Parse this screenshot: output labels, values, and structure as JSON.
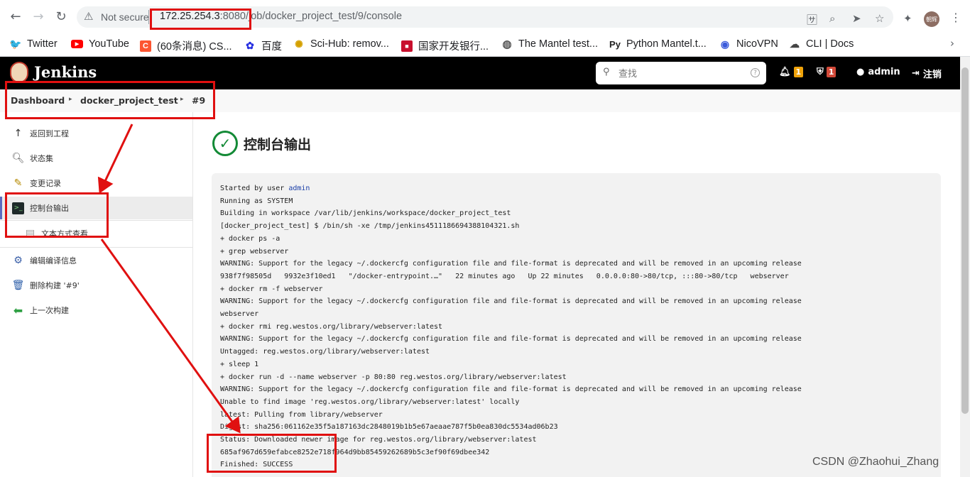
{
  "browser": {
    "security_label": "Not secure",
    "url_host": "172.25.254.3",
    "url_rest": ":8080/job/docker_project_test/9/console",
    "profile_label": "朝辉"
  },
  "bookmarks": [
    {
      "label": "Twitter",
      "color": "#1da1f2",
      "icon": "twitter-icon"
    },
    {
      "label": "YouTube",
      "color": "#ff0000",
      "icon": "youtube-icon"
    },
    {
      "label": "(60条消息) CS...",
      "color": "#fc5531",
      "icon": "csdn-icon"
    },
    {
      "label": "百度",
      "color": "#2932e1",
      "icon": "baidu-icon"
    },
    {
      "label": "Sci-Hub: remov...",
      "color": "#d4a000",
      "icon": "scihub-icon"
    },
    {
      "label": "国家开发银行...",
      "color": "#c8102e",
      "icon": "cdb-icon"
    },
    {
      "label": "The Mantel test...",
      "color": "#555555",
      "icon": "globe-icon"
    },
    {
      "label": "Python Mantel.t...",
      "color": "#222222",
      "icon": "python-icon"
    },
    {
      "label": "NicoVPN",
      "color": "#3b5bdb",
      "icon": "vpn-icon"
    },
    {
      "label": "CLI | Docs",
      "color": "#444444",
      "icon": "cloud-icon"
    }
  ],
  "jenkins": {
    "title": "Jenkins",
    "search_placeholder": "查找",
    "notifications_count": "1",
    "security_count": "1",
    "user": "admin",
    "logout": "注销",
    "colors": {
      "notif_badge": "#f0a30a",
      "security_badge": "#d24939",
      "success": "#138a36",
      "active_bar": "#5c6bc0"
    }
  },
  "breadcrumb": {
    "items": [
      "Dashboard",
      "docker_project_test",
      "#9"
    ]
  },
  "sidebar": {
    "items": [
      {
        "label": "返回到工程",
        "icon": "arrow-up-icon"
      },
      {
        "label": "状态集",
        "icon": "search-icon"
      },
      {
        "label": "变更记录",
        "icon": "notepad-icon"
      },
      {
        "label": "控制台输出",
        "icon": "terminal-icon"
      },
      {
        "label": "文本方式查看",
        "icon": "document-icon"
      },
      {
        "label": "编辑编译信息",
        "icon": "gear-icon"
      },
      {
        "label": "删除构建 '#9'",
        "icon": "trash-icon"
      },
      {
        "label": "上一次构建",
        "icon": "arrow-left-icon"
      }
    ]
  },
  "main": {
    "title": "控制台输出",
    "console_user": "admin",
    "console_lines": [
      "Started by user ",
      "Running as SYSTEM",
      "Building in workspace /var/lib/jenkins/workspace/docker_project_test",
      "[docker_project_test] $ /bin/sh -xe /tmp/jenkins4511186694388104321.sh",
      "+ docker ps -a",
      "+ grep webserver",
      "WARNING: Support for the legacy ~/.dockercfg configuration file and file-format is deprecated and will be removed in an upcoming release",
      "938f7f98505d   9932e3f10ed1   \"/docker-entrypoint.…\"   22 minutes ago   Up 22 minutes   0.0.0.0:80->80/tcp, :::80->80/tcp   webserver",
      "+ docker rm -f webserver",
      "WARNING: Support for the legacy ~/.dockercfg configuration file and file-format is deprecated and will be removed in an upcoming release",
      "webserver",
      "+ docker rmi reg.westos.org/library/webserver:latest",
      "WARNING: Support for the legacy ~/.dockercfg configuration file and file-format is deprecated and will be removed in an upcoming release",
      "Untagged: reg.westos.org/library/webserver:latest",
      "+ sleep 1",
      "+ docker run -d --name webserver -p 80:80 reg.westos.org/library/webserver:latest",
      "WARNING: Support for the legacy ~/.dockercfg configuration file and file-format is deprecated and will be removed in an upcoming release",
      "Unable to find image 'reg.westos.org/library/webserver:latest' locally",
      "latest: Pulling from library/webserver",
      "Digest: sha256:061162e35f5a187163dc2848019b1b5e67aeaae787f5b0ea830dc5534ad06b23",
      "Status: Downloaded newer image for reg.westos.org/library/webserver:latest",
      "685af967d659efabce8252e718f964d9bb85459262689b5c3ef90f69dbee342",
      "Finished: SUCCESS"
    ]
  },
  "watermark": "CSDN @Zhaohui_Zhang"
}
